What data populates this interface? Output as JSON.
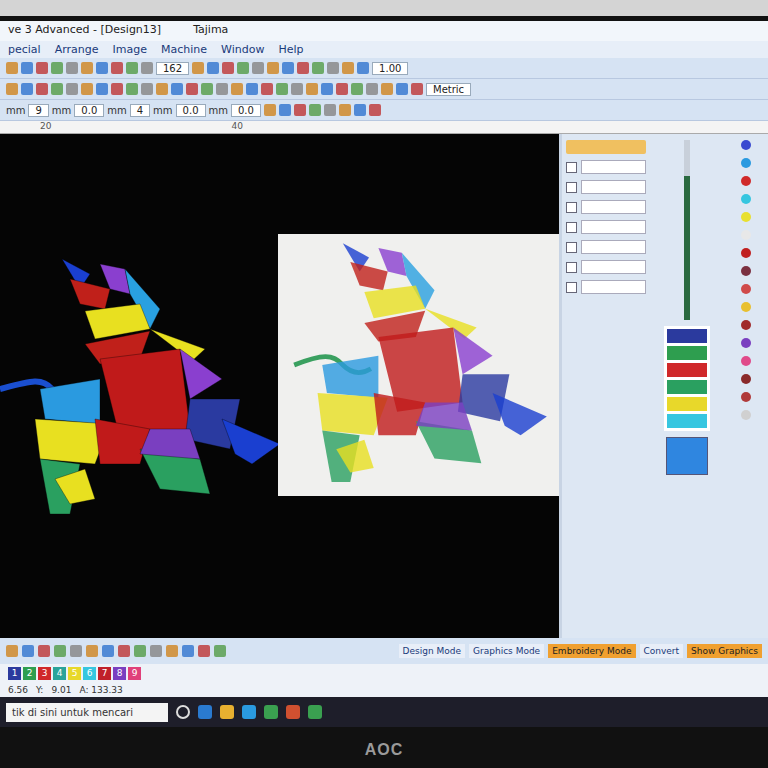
{
  "window": {
    "title": "ve 3 Advanced - [Design13]",
    "machine": "Tajima"
  },
  "menu": [
    "pecial",
    "Arrange",
    "Image",
    "Machine",
    "Window",
    "Help"
  ],
  "toolbar": {
    "zoom": "162",
    "scale": "1.00",
    "units": "Metric"
  },
  "fields": {
    "unit": "mm",
    "values": [
      "9",
      "0.0",
      "4",
      "0.0",
      "0.0"
    ]
  },
  "ruler": [
    "20",
    "40"
  ],
  "modes": [
    {
      "label": "Design Mode",
      "selected": false
    },
    {
      "label": "Graphics Mode",
      "selected": false
    },
    {
      "label": "Embroidery Mode",
      "selected": true
    },
    {
      "label": "Convert",
      "selected": false
    },
    {
      "label": "Show Graphics",
      "selected": true
    }
  ],
  "threads": [
    {
      "number": "1",
      "color": "#2b3a9e"
    },
    {
      "number": "2",
      "color": "#2e9e4f"
    },
    {
      "number": "3",
      "color": "#d0282a"
    },
    {
      "number": "4",
      "color": "#2aa39a"
    },
    {
      "number": "5",
      "color": "#e8d82a"
    },
    {
      "number": "6",
      "color": "#36c6e0"
    },
    {
      "number": "7",
      "color": "#c0202a"
    },
    {
      "number": "8",
      "color": "#7a3fc0"
    },
    {
      "number": "9",
      "color": "#e0407a"
    }
  ],
  "palette": [
    "#3a4ad0",
    "#2a9ae0",
    "#d02a2a",
    "#36c6e0",
    "#e8e030",
    "#e8e8e8",
    "#c02020",
    "#7a3040",
    "#d04a4a",
    "#e8c030",
    "#a02a2a",
    "#7a3fc0",
    "#e04a8a",
    "#8a2a2a",
    "#b03a3a",
    "#d0d0d0"
  ],
  "color_list": [
    "#2b3a9e",
    "#2e9e4f",
    "#d0282a",
    "#2aa060",
    "#e8d82a",
    "#36c6e0"
  ],
  "current_color": "#2f86e0",
  "slider": {
    "level": 0.8
  },
  "status": [
    "6.56",
    "Y:",
    "9.01",
    "A: 133.33"
  ],
  "taskbar": {
    "search": "tik di sini untuk mencari"
  },
  "monitor": {
    "brand": "AOC"
  }
}
